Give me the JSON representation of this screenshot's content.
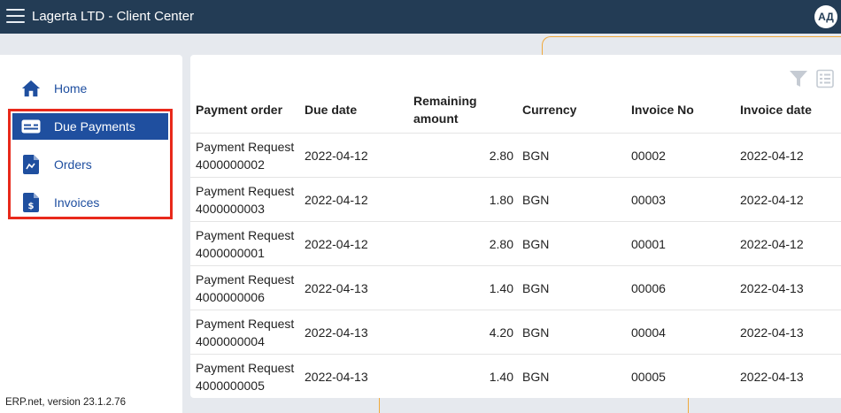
{
  "app": {
    "title": "Lagerta LTD - Client Center",
    "user_initials": "АД"
  },
  "sidebar": {
    "items": [
      {
        "label": "Home",
        "icon": "home-icon",
        "active": false
      },
      {
        "label": "Due Payments",
        "icon": "payment-card-icon",
        "active": true
      },
      {
        "label": "Orders",
        "icon": "order-document-icon",
        "active": false
      },
      {
        "label": "Invoices",
        "icon": "invoice-document-icon",
        "active": false
      }
    ],
    "version": "ERP.net, version 23.1.2.76"
  },
  "toolbar": {
    "icons": [
      "filter-icon",
      "column-list-icon"
    ]
  },
  "table": {
    "headers": [
      "Payment order",
      "Due date",
      "Remaining amount",
      "Currency",
      "Invoice No",
      "Invoice date"
    ],
    "rows": [
      {
        "order_line1": "Payment Request",
        "order_line2": "4000000002",
        "due": "2022-04-12",
        "remaining": "2.80",
        "currency": "BGN",
        "invoice_no": "00002",
        "invoice_date": "2022-04-12"
      },
      {
        "order_line1": "Payment Request",
        "order_line2": "4000000003",
        "due": "2022-04-12",
        "remaining": "1.80",
        "currency": "BGN",
        "invoice_no": "00003",
        "invoice_date": "2022-04-12"
      },
      {
        "order_line1": "Payment Request",
        "order_line2": "4000000001",
        "due": "2022-04-12",
        "remaining": "2.80",
        "currency": "BGN",
        "invoice_no": "00001",
        "invoice_date": "2022-04-12"
      },
      {
        "order_line1": "Payment Request",
        "order_line2": "4000000006",
        "due": "2022-04-13",
        "remaining": "1.40",
        "currency": "BGN",
        "invoice_no": "00006",
        "invoice_date": "2022-04-13"
      },
      {
        "order_line1": "Payment Request",
        "order_line2": "4000000004",
        "due": "2022-04-13",
        "remaining": "4.20",
        "currency": "BGN",
        "invoice_no": "00004",
        "invoice_date": "2022-04-13"
      },
      {
        "order_line1": "Payment Request",
        "order_line2": "4000000005",
        "due": "2022-04-13",
        "remaining": "1.40",
        "currency": "BGN",
        "invoice_no": "00005",
        "invoice_date": "2022-04-13"
      }
    ]
  },
  "colors": {
    "topbar": "#233c55",
    "accent": "#1f4f9f",
    "highlight": "#e8291b",
    "outline": "#f0a93c"
  }
}
